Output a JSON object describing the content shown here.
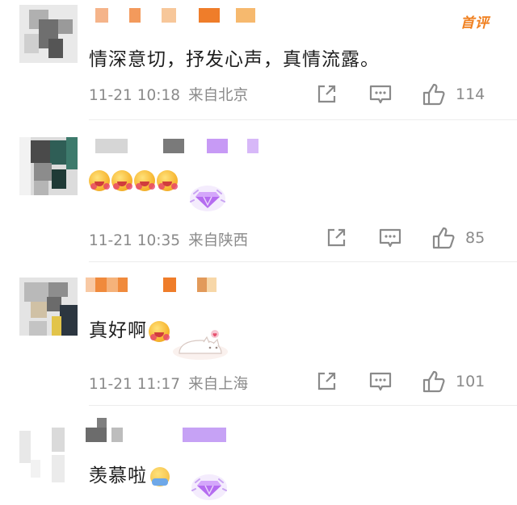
{
  "top_badge": "首评",
  "comments": [
    {
      "text": "情深意切，抒发心声，真情流露。",
      "date": "11-21",
      "time": "10:18",
      "location": "来自北京",
      "likes": "114"
    },
    {
      "text": "",
      "emoji_count": 4,
      "date": "11-21",
      "time": "10:35",
      "location": "来自陕西",
      "likes": "85"
    },
    {
      "text": "真好啊",
      "date": "11-21",
      "time": "11:17",
      "location": "来自上海",
      "likes": "101"
    },
    {
      "text": "羡慕啦"
    }
  ],
  "colors": {
    "accent_orange": "#f08020",
    "meta_gray": "#8a8a8a",
    "purple_gem": "#b56cf0"
  },
  "icons": [
    "share-icon",
    "comment-icon",
    "thumbs-up-icon",
    "gem-badge-icon"
  ]
}
